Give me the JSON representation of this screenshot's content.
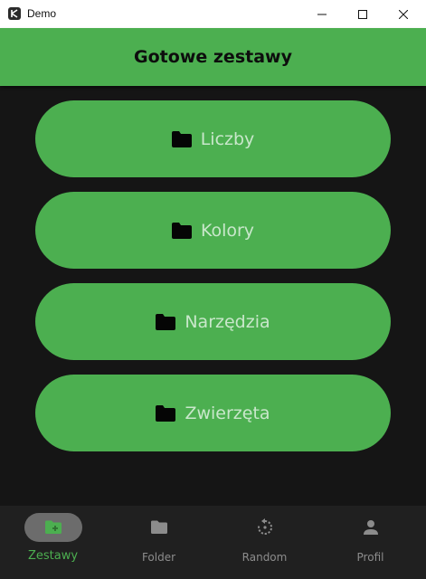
{
  "window": {
    "title": "Demo",
    "icon": "kivy-logo-icon"
  },
  "appbar": {
    "title": "Gotowe zestawy"
  },
  "sets": [
    {
      "label": "Liczby",
      "icon": "folder-icon"
    },
    {
      "label": "Kolory",
      "icon": "folder-icon"
    },
    {
      "label": "Narzędzia",
      "icon": "folder-icon"
    },
    {
      "label": "Zwierzęta",
      "icon": "folder-icon"
    }
  ],
  "bottom_nav": {
    "items": [
      {
        "label": "Zestawy",
        "icon": "folder-plus-icon",
        "active": true
      },
      {
        "label": "Folder",
        "icon": "folder-icon",
        "active": false
      },
      {
        "label": "Random",
        "icon": "rotate-icon",
        "active": false
      },
      {
        "label": "Profil",
        "icon": "person-icon",
        "active": false
      }
    ]
  },
  "colors": {
    "accent": "#4caf50",
    "background": "#151515",
    "nav_background": "#202020",
    "button_text": "#c9e7cb",
    "inactive": "#8c8c8c"
  }
}
